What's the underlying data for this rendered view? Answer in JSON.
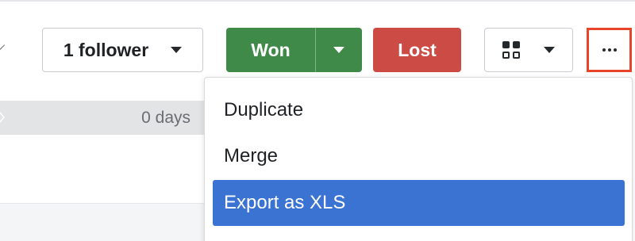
{
  "header": {
    "follower_label": "1 follower",
    "won_label": "Won",
    "lost_label": "Lost"
  },
  "stage": {
    "days_label": "0 days"
  },
  "more_menu": {
    "items": [
      {
        "label": "Duplicate",
        "active": false
      },
      {
        "label": "Merge",
        "active": false
      },
      {
        "label": "Export as XLS",
        "active": true
      }
    ]
  },
  "colors": {
    "won": "#3f8a48",
    "lost": "#cc4b45",
    "highlight": "#3b73d3",
    "focus_outline": "#e8442a"
  }
}
